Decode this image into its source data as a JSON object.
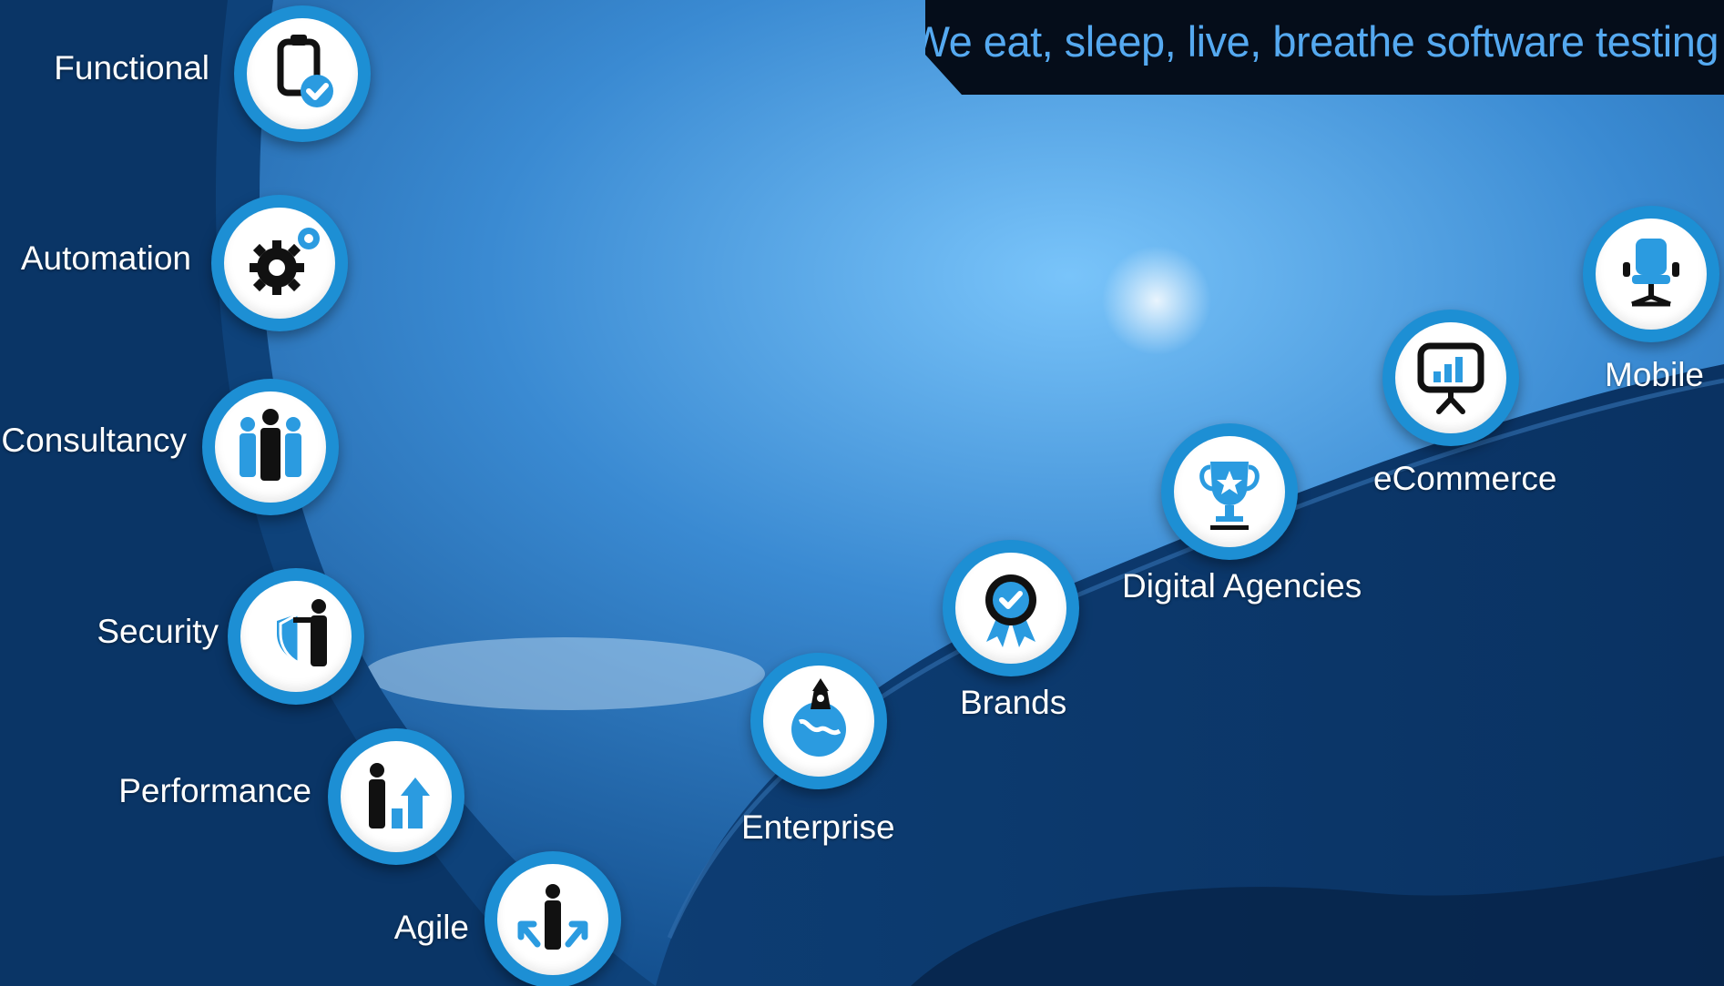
{
  "banner": {
    "tagline": "We eat, sleep, live, breathe software testing"
  },
  "services": [
    {
      "label": "Functional",
      "icon": "clipboard-check-icon"
    },
    {
      "label": "Automation",
      "icon": "gears-icon"
    },
    {
      "label": "Consultancy",
      "icon": "team-icon"
    },
    {
      "label": "Security",
      "icon": "shield-person-icon"
    },
    {
      "label": "Performance",
      "icon": "growth-chart-person-icon"
    },
    {
      "label": "Agile",
      "icon": "person-arrows-icon"
    }
  ],
  "clients": [
    {
      "label": "Enterprise",
      "icon": "rocket-globe-icon"
    },
    {
      "label": "Brands",
      "icon": "award-ribbon-icon"
    },
    {
      "label": "Digital Agencies",
      "icon": "trophy-icon"
    },
    {
      "label": "eCommerce",
      "icon": "presentation-board-icon"
    },
    {
      "label": "Mobile",
      "icon": "office-chair-icon"
    }
  ],
  "colors": {
    "accent": "#1d8fd4",
    "icon_blue": "#2b9be0",
    "icon_dark": "#111111",
    "banner_bg": "#050d1a",
    "banner_text": "#55a9f0",
    "label_text": "#ffffff"
  }
}
